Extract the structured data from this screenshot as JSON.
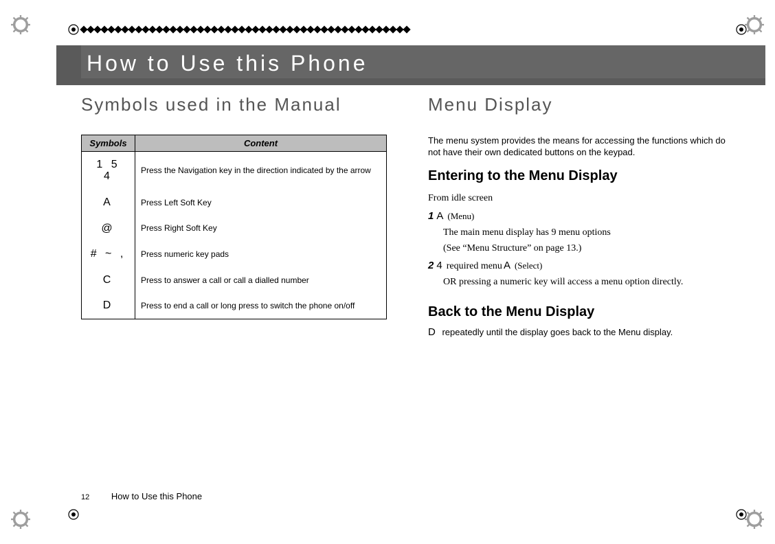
{
  "title": "How to Use this Phone",
  "left": {
    "heading": "Symbols used in the Manual",
    "table": {
      "headers": {
        "symbols": "Symbols",
        "content": "Content"
      },
      "rows": [
        {
          "symbol": "1   5\n4",
          "content": "Press the Navigation key in the direction indicated by the arrow"
        },
        {
          "symbol": "A",
          "content": "Press Left Soft Key"
        },
        {
          "symbol": "@",
          "content": "Press Right Soft Key"
        },
        {
          "symbol": "#   ~ ,",
          "content": "Press numeric key pads"
        },
        {
          "symbol": "C",
          "content": "Press to answer a call or call a dialled number"
        },
        {
          "symbol": "D",
          "content": "Press to end a call or long press to switch the phone on/off"
        }
      ]
    }
  },
  "right": {
    "heading": "Menu Display",
    "intro": "The menu system provides the means for accessing the functions which do not have their own dedicated buttons on the keypad.",
    "section1": {
      "title": "Entering to the Menu Display",
      "lead": "From idle screen",
      "step1_num": "1",
      "step1_icon": "A",
      "step1_label": "(Menu)",
      "step1_body1": "The main menu display has 9 menu options",
      "step1_body2": "(See “Menu Structure” on page 13.)",
      "step2_num": "2",
      "step2_icon": "4",
      "step2_text": "required menu",
      "step2_icon2": "A",
      "step2_label": "(Select)",
      "step2_body": "OR pressing a numeric key will access a menu option directly."
    },
    "section2": {
      "title": "Back to the Menu Display",
      "icon": "D",
      "text": "repeatedly until the display goes back to the Menu display."
    }
  },
  "footer": {
    "page_number": "12",
    "title": "How to Use this Phone"
  }
}
